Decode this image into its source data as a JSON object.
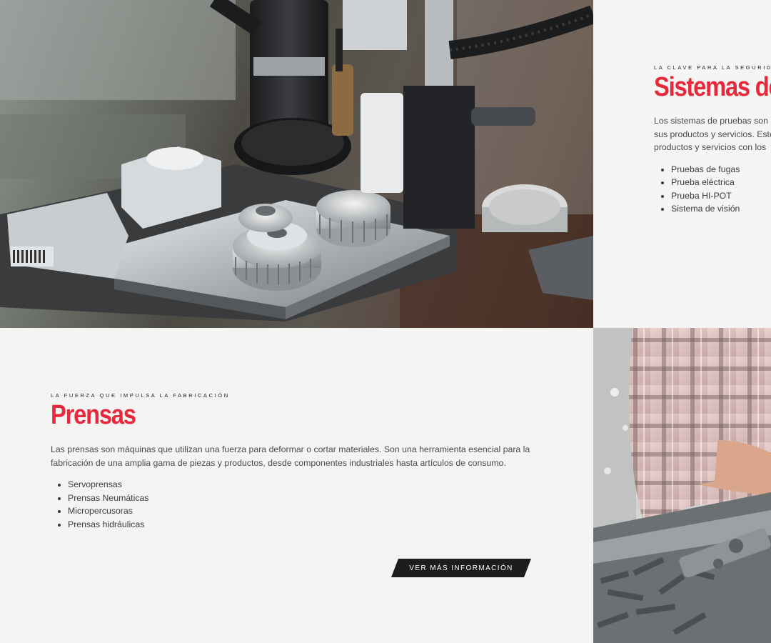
{
  "sections": [
    {
      "eyebrow": "LA CLAVE PARA LA SEGURIDAD",
      "title": "Sistemas de",
      "description": [
        "Los sistemas de pruebas son",
        "sus productos y servicios. Este",
        "productos y servicios con los"
      ],
      "items": [
        "Pruebas de fugas",
        "Prueba eléctrica",
        "Prueba HI-POT",
        "Sistema de visión"
      ]
    },
    {
      "eyebrow": "LA FUERZA QUE IMPULSA LA FABRICACIÓN",
      "title": "Prensas",
      "description": "Las prensas son máquinas que utilizan una fuerza para deformar o cortar materiales. Son una herramienta esencial para la fabricación de una amplia gama de piezas y productos, desde componentes industriales hasta artículos de consumo.",
      "items": [
        "Servoprensas",
        "Prensas Neumáticas",
        "Micropercusoras",
        "Prensas hidráulicas"
      ],
      "cta_label": "VER MÁS INFORMACIÓN"
    }
  ],
  "images": {
    "top": {
      "icon": "testing-machine-gears-photo"
    },
    "bottom": {
      "icon": "worker-metal-parts-photo"
    }
  },
  "colors": {
    "accent": "#e8293c",
    "cta_bg": "#1d1d1d",
    "background": "#f4f4f3"
  }
}
